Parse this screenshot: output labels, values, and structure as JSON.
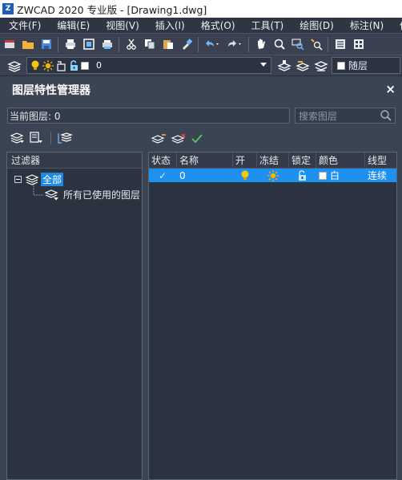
{
  "window": {
    "title": "ZWCAD 2020 专业版 - [Drawing1.dwg]",
    "app_icon_glyph": "Z"
  },
  "menu": [
    {
      "label": "文件(F)"
    },
    {
      "label": "编辑(E)"
    },
    {
      "label": "视图(V)"
    },
    {
      "label": "插入(I)"
    },
    {
      "label": "格式(O)"
    },
    {
      "label": "工具(T)"
    },
    {
      "label": "绘图(D)"
    },
    {
      "label": "标注(N)"
    },
    {
      "label": "修"
    }
  ],
  "toolbar": {
    "icons": [
      "new-icon",
      "open-icon",
      "save-icon",
      "print-icon",
      "preview-icon",
      "plot-icon",
      "cut-icon",
      "copy-icon",
      "paste-icon",
      "match-properties-icon",
      "undo-icon",
      "redo-icon",
      "pan-icon",
      "zoom-realtime-icon",
      "zoom-window-icon",
      "zoom-previous-icon",
      "properties-icon",
      "design-center-icon"
    ]
  },
  "layer_bar": {
    "current_layer": "0",
    "linetype_value": "随层"
  },
  "panel": {
    "title": "图层特性管理器",
    "close_glyph": "×",
    "current_layer_label": "当前图层: 0",
    "search_placeholder": "搜索图层"
  },
  "filters": {
    "header": "过滤器",
    "root_label": "全部",
    "child_label": "所有已使用的图层"
  },
  "layer_table": {
    "columns": [
      "状态",
      "名称",
      "开",
      "冻结",
      "锁定",
      "颜色",
      "线型"
    ],
    "rows": [
      {
        "status": "✓",
        "name": "0",
        "on": true,
        "frozen": false,
        "locked": false,
        "color_name": "白",
        "color_hex": "#ffffff",
        "linetype": "连续"
      }
    ]
  },
  "colors": {
    "accent": "#1e90f0",
    "panel_bg": "#3b4453",
    "bulb": "#f7c40f",
    "sun": "#f4b400",
    "lock": "#8fd3ff",
    "check": "#5cc85c"
  }
}
